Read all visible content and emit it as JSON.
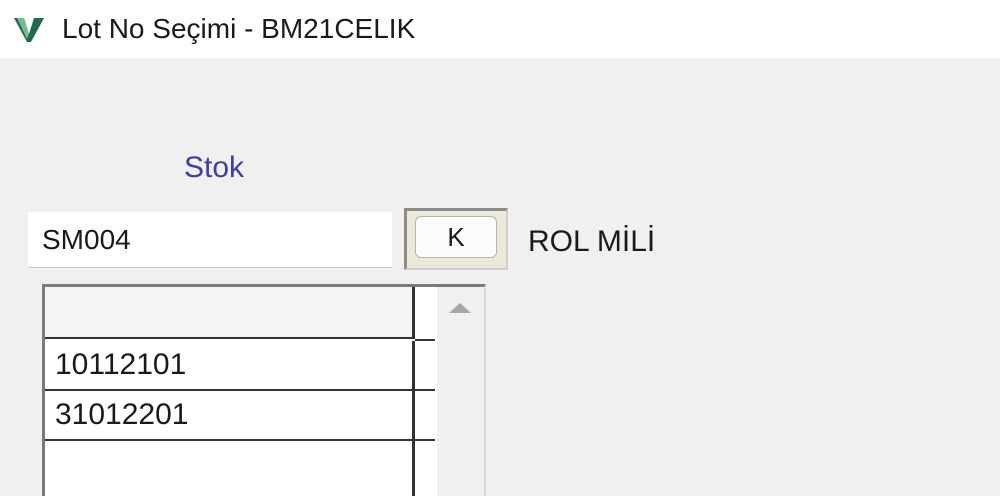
{
  "window": {
    "title": "Lot No Seçimi - BM21CELIK",
    "icon": "v-logo-icon"
  },
  "form": {
    "stok_label": "Stok",
    "stok_value": "SM004",
    "k_button_label": "K",
    "stok_description": "ROL MİLİ"
  },
  "lot_grid": {
    "header": "",
    "rows": [
      {
        "lot_no": "10112101"
      },
      {
        "lot_no": "31012201"
      }
    ]
  },
  "colors": {
    "accent_label": "#3d3dae",
    "icon_green_dark": "#1f6b4e",
    "icon_green_light": "#6fbf8f"
  }
}
